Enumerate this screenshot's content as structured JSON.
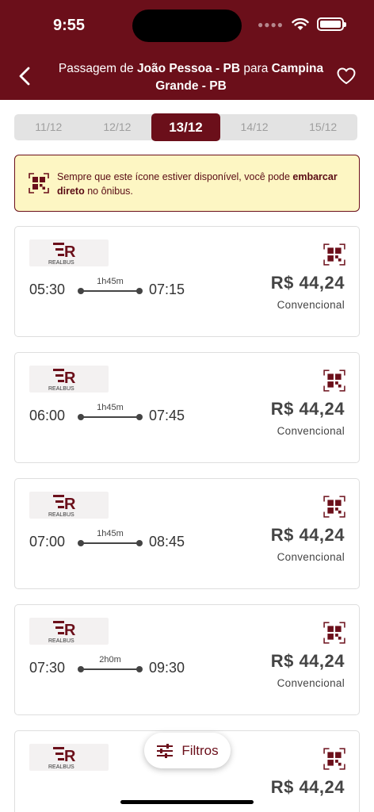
{
  "status": {
    "time": "9:55"
  },
  "header": {
    "title_prefix": "Passagem de ",
    "origin": "João Pessoa - PB",
    "title_middle": " para ",
    "destination": "Campina Grande - PB"
  },
  "dates": [
    {
      "label": "11/12",
      "active": false
    },
    {
      "label": "12/12",
      "active": false
    },
    {
      "label": "13/12",
      "active": true
    },
    {
      "label": "14/12",
      "active": false
    },
    {
      "label": "15/12",
      "active": false
    }
  ],
  "notice": {
    "text_part1": "Sempre que este ícone estiver disponível, você pode ",
    "text_bold": "embarcar direto",
    "text_part2": "  no ônibus."
  },
  "company": {
    "logo_main": "ER",
    "logo_sub": "REALBUS"
  },
  "trips": [
    {
      "departure": "05:30",
      "duration": "1h45m",
      "arrival": "07:15",
      "price": "R$ 44,24",
      "class": "Convencional"
    },
    {
      "departure": "06:00",
      "duration": "1h45m",
      "arrival": "07:45",
      "price": "R$ 44,24",
      "class": "Convencional"
    },
    {
      "departure": "07:00",
      "duration": "1h45m",
      "arrival": "08:45",
      "price": "R$ 44,24",
      "class": "Convencional"
    },
    {
      "departure": "07:30",
      "duration": "2h0m",
      "arrival": "09:30",
      "price": "R$ 44,24",
      "class": "Convencional"
    },
    {
      "departure": "",
      "duration": "",
      "arrival": "",
      "price": "R$ 44,24",
      "class": ""
    }
  ],
  "filter": {
    "label": "Filtros",
    "icon": "sliders-icon"
  },
  "colors": {
    "brand": "#6b0f1a",
    "notice_bg": "#fdf6c3",
    "tab_bg": "#e3e3e3"
  }
}
